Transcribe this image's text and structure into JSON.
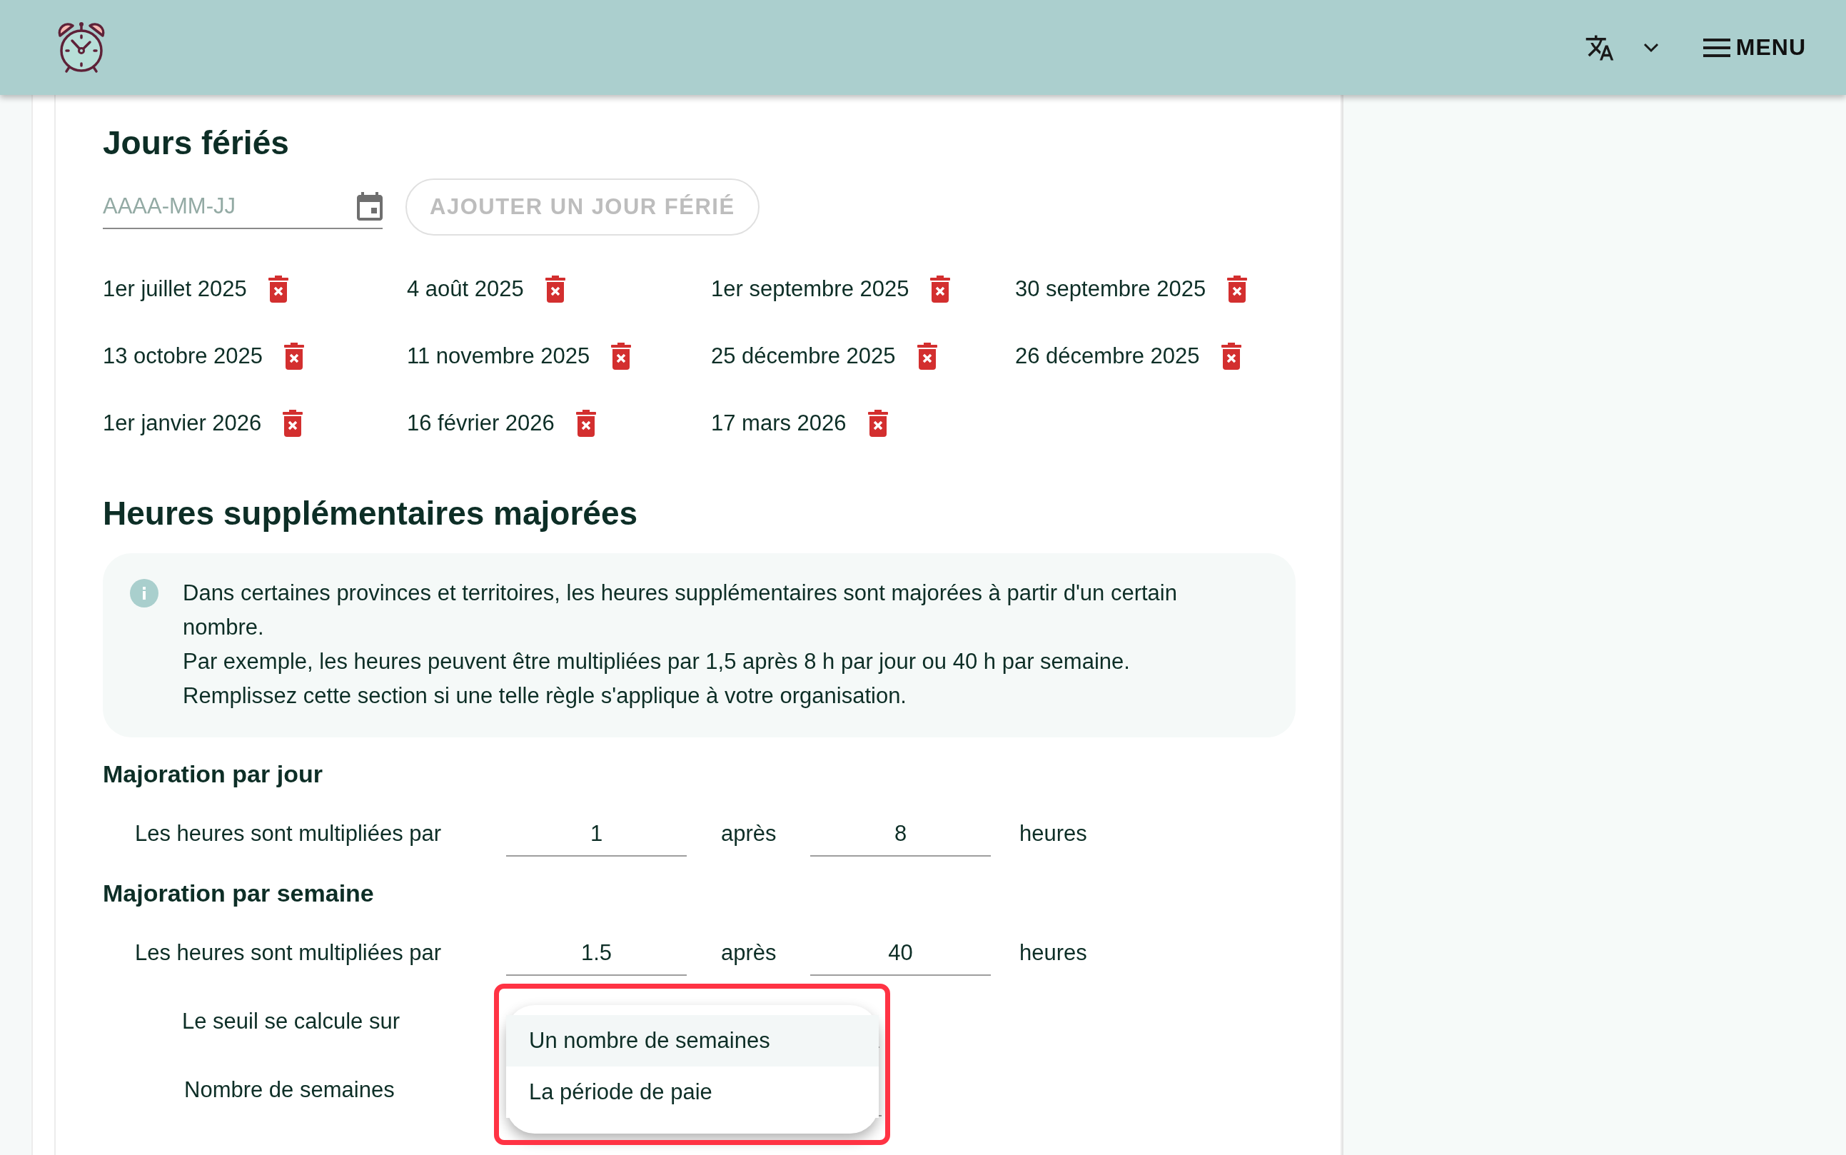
{
  "header": {
    "language_menu": {
      "expanded": false
    },
    "menu_button": {
      "label": "MENU"
    }
  },
  "holidays": {
    "title": "Jours fériés",
    "date_field": {
      "placeholder": "AAAA-MM-JJ"
    },
    "add_button": {
      "label": "AJOUTER UN JOUR FÉRIÉ",
      "disabled": true
    },
    "items": [
      "1er juillet 2025",
      "4 août 2025",
      "1er septembre 2025",
      "30 septembre 2025",
      "13 octobre 2025",
      "11 novembre 2025",
      "25 décembre 2025",
      "26 décembre 2025",
      "1er janvier 2026",
      "16 février 2026",
      "17 mars 2026"
    ]
  },
  "overtime": {
    "title": "Heures supplémentaires majorées",
    "info": [
      "Dans certaines provinces et territoires, les heures supplémentaires sont majorées à partir d'un certain nombre.",
      "Par exemple, les heures peuvent être multipliées par 1,5 après 8 h par jour ou 40 h par semaine.",
      "Remplissez cette section si une telle règle s'applique à votre organisation."
    ],
    "sections": [
      {
        "title": "Majoration par jour",
        "label": "Les heures sont multipliées par",
        "multiplier": "1",
        "after": "après",
        "hours": "8",
        "unit": "heures"
      },
      {
        "title": "Majoration par semaine",
        "label": "Les heures sont multipliées par",
        "multiplier": "1.5",
        "after": "après",
        "hours": "40",
        "unit": "heures"
      }
    ],
    "threshold": {
      "label": "Le seuil se calcule sur",
      "expanded": true,
      "options": [
        {
          "label": "Un nombre de semaines",
          "selected": true
        },
        {
          "label": "La période de paie",
          "selected": false
        }
      ]
    },
    "weeks": {
      "label": "Nombre de semaines"
    }
  }
}
